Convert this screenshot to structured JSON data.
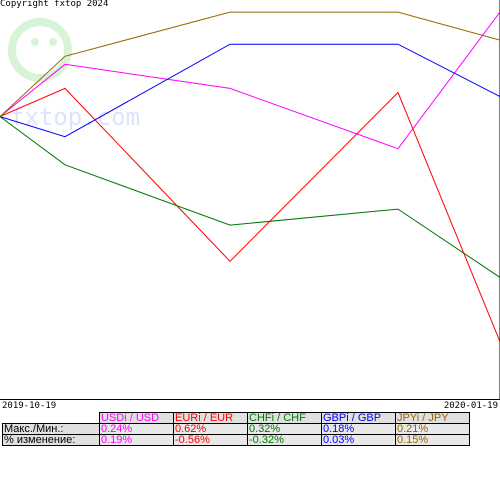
{
  "copyright": "Copyright fxtop 2024",
  "watermark": "fxtop.com",
  "chart_data": {
    "type": "line",
    "x_start_label": "2019-10-19",
    "x_end_label": "2020-01-19",
    "x": [
      0,
      1,
      2,
      3,
      4
    ],
    "series": [
      {
        "name": "USDi / USD",
        "color": "#ff00ff",
        "values": [
          0.0,
          0.13,
          0.07,
          -0.08,
          0.26
        ]
      },
      {
        "name": "EURi / EUR",
        "color": "#ff0000",
        "values": [
          0.0,
          0.07,
          -0.36,
          0.06,
          -0.56
        ]
      },
      {
        "name": "CHFi / CHF",
        "color": "#007700",
        "values": [
          0.0,
          -0.12,
          -0.27,
          -0.23,
          -0.4
        ]
      },
      {
        "name": "GBPi / GBP",
        "color": "#0000ff",
        "values": [
          0.0,
          -0.05,
          0.18,
          0.18,
          0.05
        ]
      },
      {
        "name": "JPYi / JPY",
        "color": "#996600",
        "values": [
          0.0,
          0.15,
          0.26,
          0.26,
          0.19
        ]
      }
    ],
    "ylim": [
      -0.7,
      0.29
    ],
    "grid": false
  },
  "table": {
    "row_labels": [
      "Макс./Мин.:",
      "% изменение:"
    ],
    "columns": [
      {
        "name": "USDi / USD",
        "maxmin": "0.24%",
        "change": "0.19%",
        "color": "#ff00ff"
      },
      {
        "name": "EURi / EUR",
        "maxmin": "0.62%",
        "change": "-0.56%",
        "color": "#ff0000"
      },
      {
        "name": "CHFi / CHF",
        "maxmin": "0.32%",
        "change": "-0.32%",
        "color": "#007700"
      },
      {
        "name": "GBPi / GBP",
        "maxmin": "0.18%",
        "change": "0.03%",
        "color": "#0000ff"
      },
      {
        "name": "JPYi / JPY",
        "maxmin": "0.21%",
        "change": "0.15%",
        "color": "#996600"
      }
    ]
  }
}
